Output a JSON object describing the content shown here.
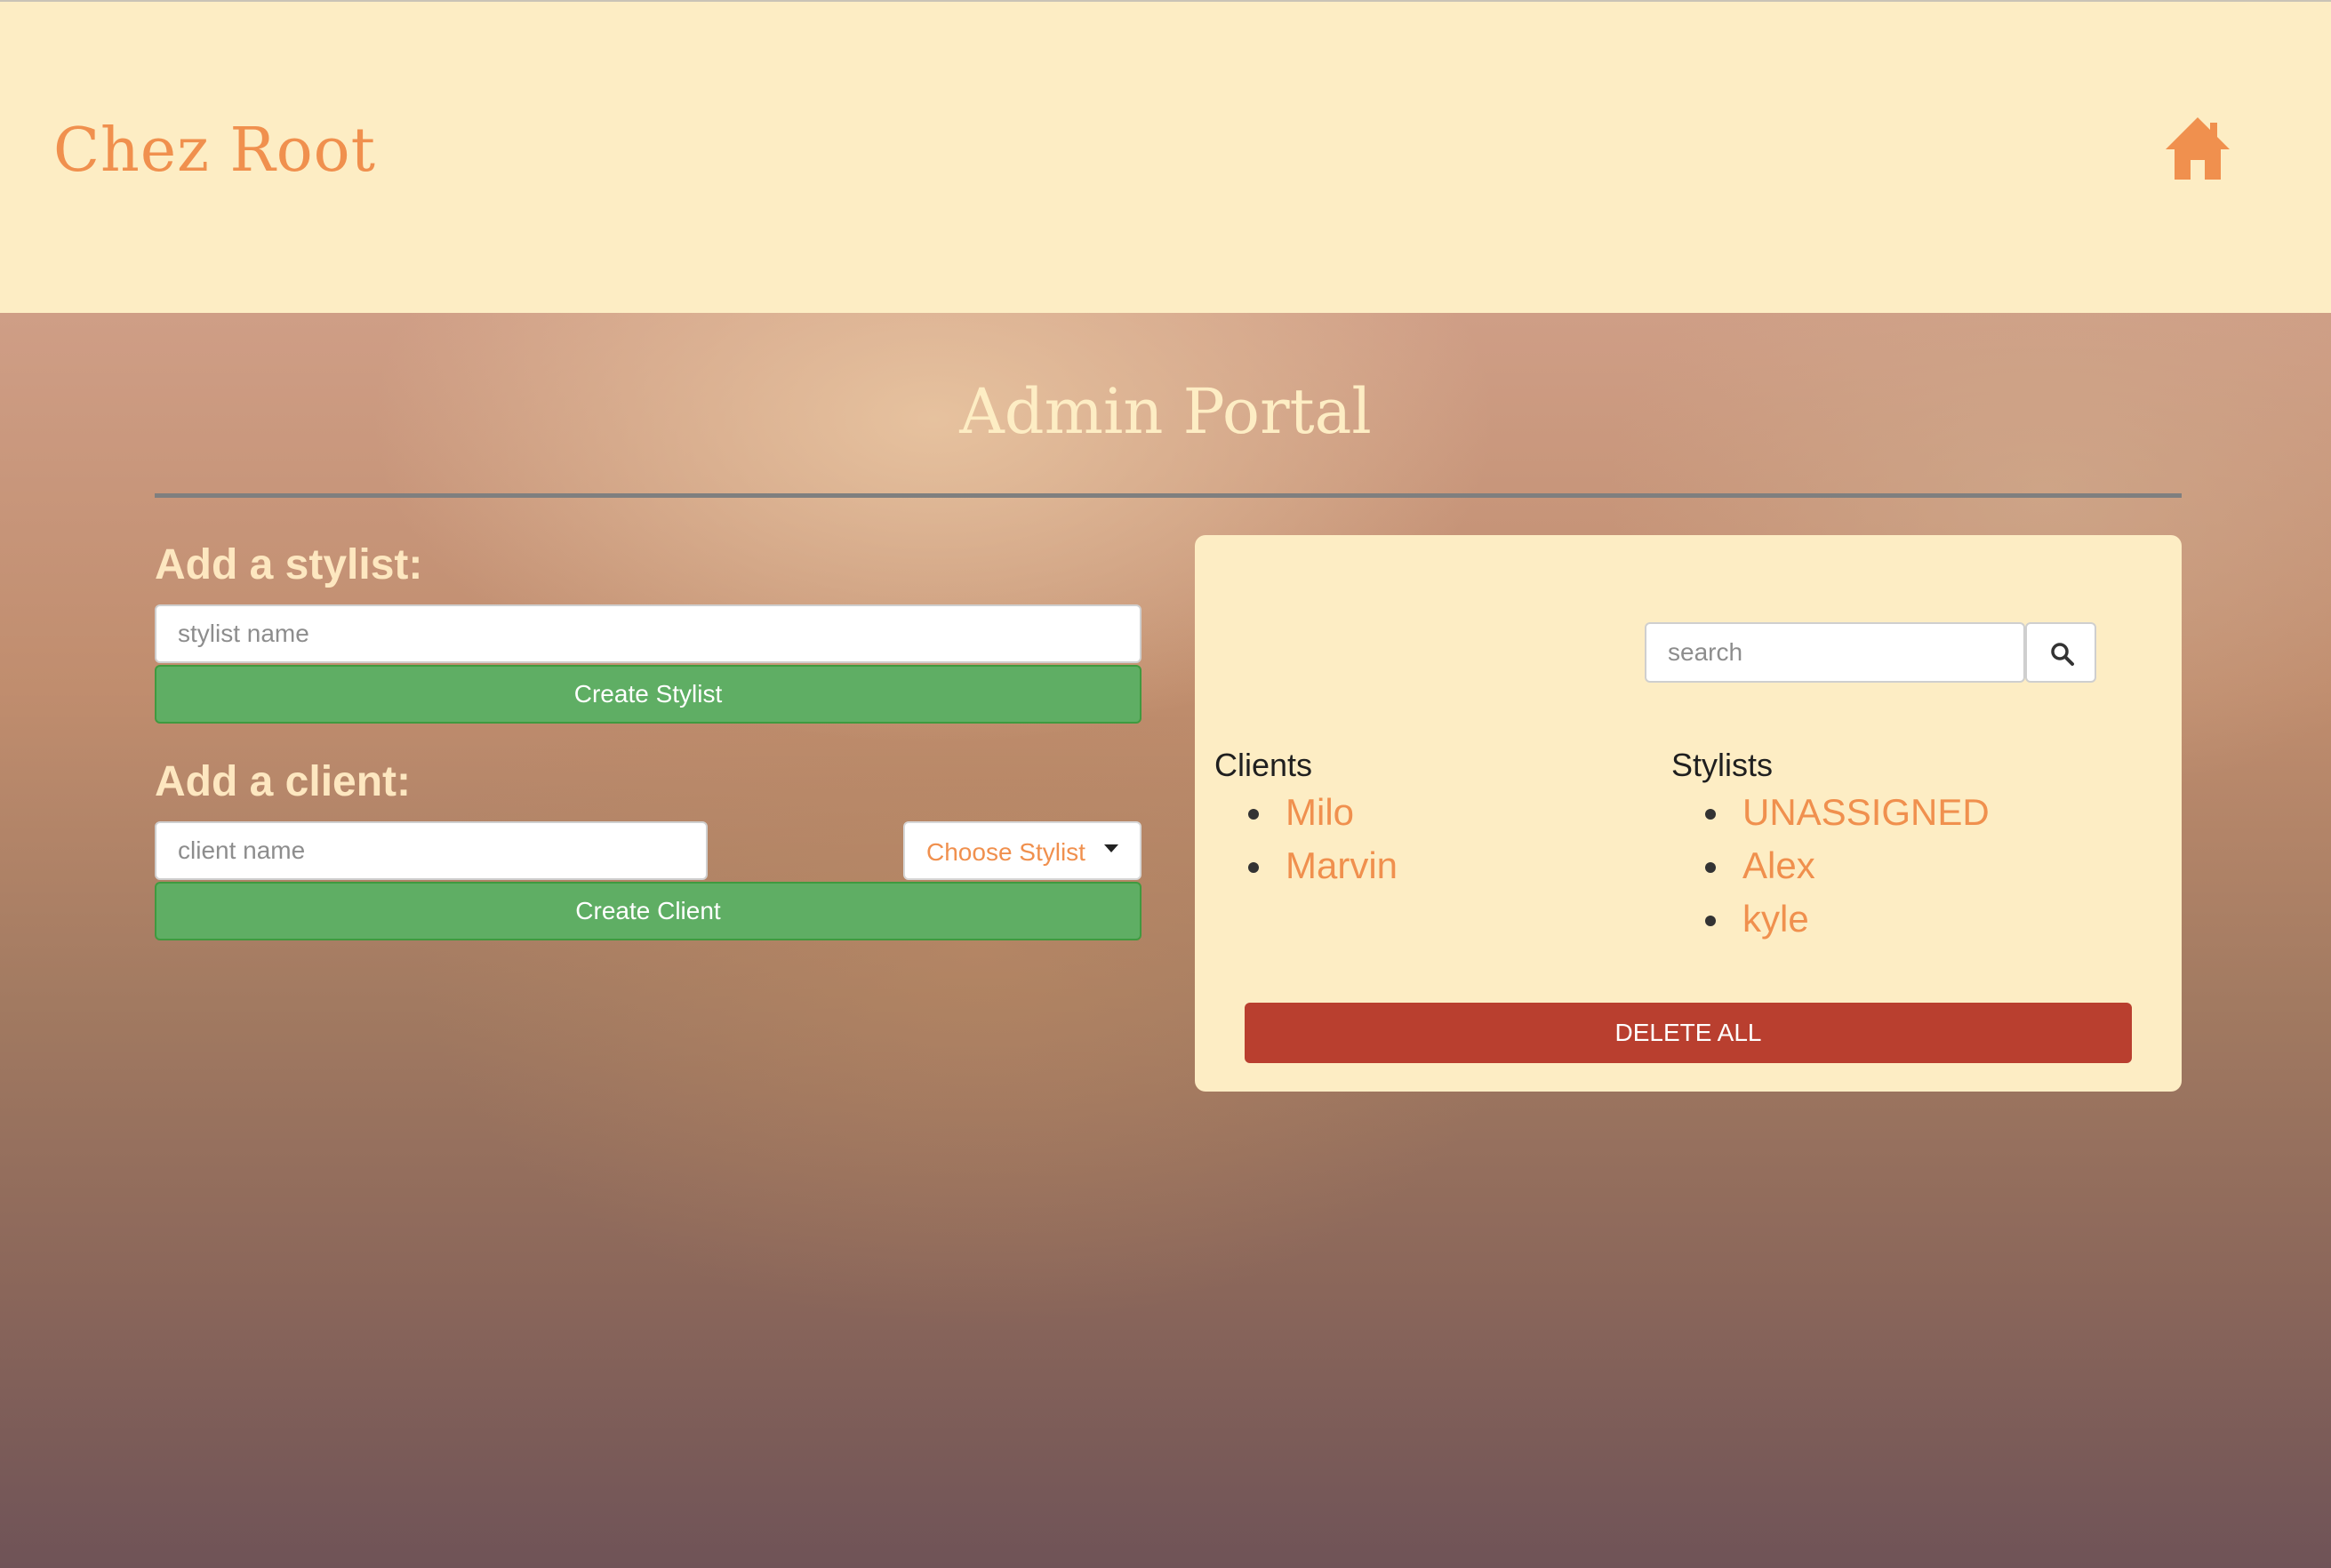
{
  "header": {
    "brand": "Chez Root",
    "home_icon": "home-icon"
  },
  "main": {
    "title": "Admin Portal",
    "add_stylist": {
      "label": "Add a stylist:",
      "name_placeholder": "stylist name",
      "create_button": "Create Stylist"
    },
    "add_client": {
      "label": "Add a client:",
      "name_placeholder": "client name",
      "stylist_select": "Choose Stylist",
      "create_button": "Create Client"
    },
    "panel": {
      "search_placeholder": "search",
      "search_icon": "search-icon",
      "clients_title": "Clients",
      "clients": [
        "Milo",
        "Marvin"
      ],
      "stylists_title": "Stylists",
      "stylists": [
        "UNASSIGNED",
        "Alex",
        "kyle"
      ],
      "delete_all": "DELETE ALL"
    }
  },
  "colors": {
    "header_bg": "#fdedc4",
    "accent": "#f0904e",
    "green": "#5fae64",
    "red": "#b93f2f"
  }
}
